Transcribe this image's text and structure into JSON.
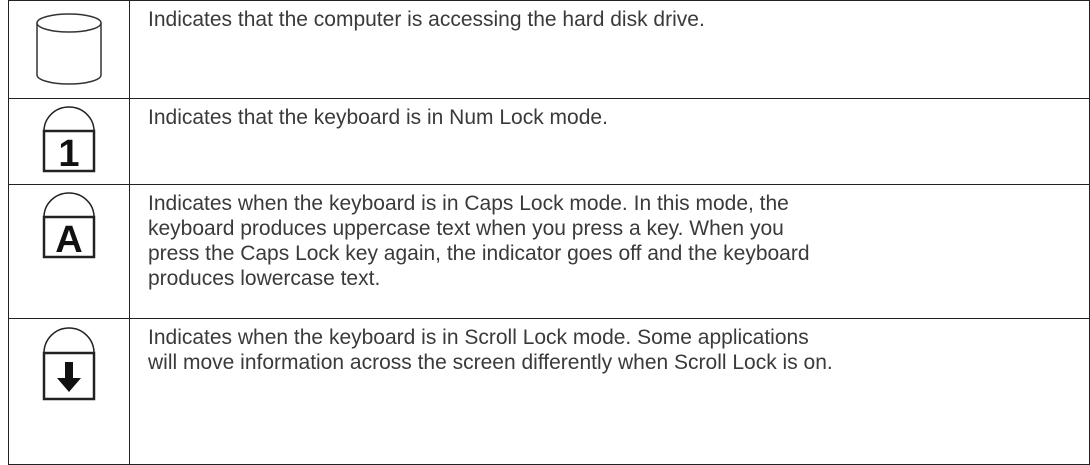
{
  "indicators": [
    {
      "icon": "hard-disk-icon",
      "lines": [
        "Indicates that the computer is accessing the hard disk drive."
      ]
    },
    {
      "icon": "num-lock-icon",
      "glyph": "1",
      "lines": [
        "Indicates that the keyboard is in Num Lock mode."
      ]
    },
    {
      "icon": "caps-lock-icon",
      "glyph": "A",
      "lines": [
        "Indicates when the keyboard is in Caps Lock mode.  In this mode, the",
        "keyboard produces uppercase text when you press a key.  When you",
        "press the Caps Lock key again, the indicator goes off and the keyboard",
        "produces lowercase text."
      ]
    },
    {
      "icon": "scroll-lock-icon",
      "lines": [
        "Indicates when the keyboard is in Scroll Lock mode.  Some applications",
        "will move information across the screen differently when Scroll Lock is on."
      ]
    }
  ]
}
